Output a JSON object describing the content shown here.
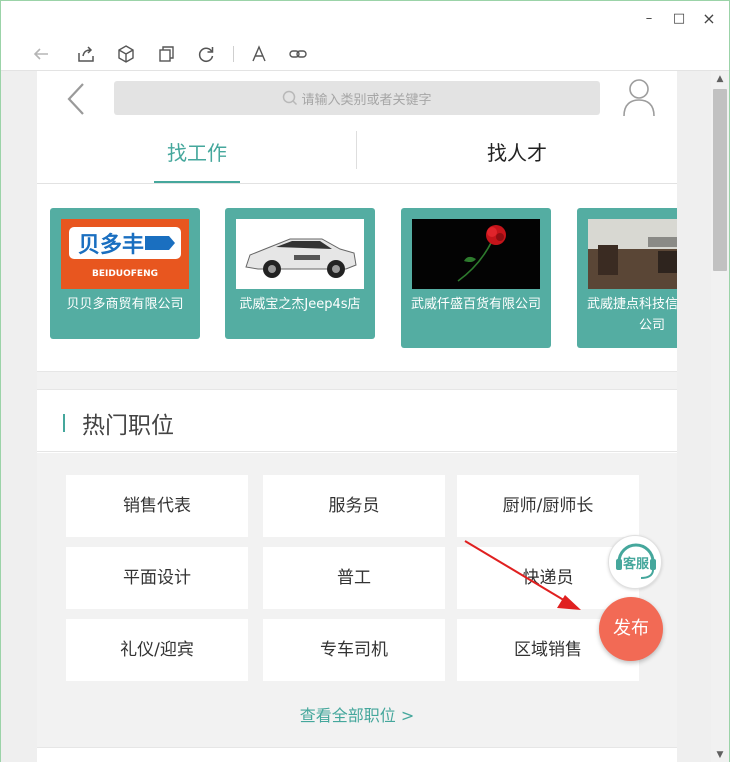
{
  "window": {
    "controls": {
      "minimize": "–",
      "maximize": "□",
      "close": "×"
    }
  },
  "toolbar": {
    "icons": [
      "back-arrow-icon",
      "share-icon",
      "cube-icon",
      "copy-icon",
      "refresh-icon",
      "font-icon",
      "link-icon"
    ]
  },
  "header": {
    "search_placeholder": "请输入类别或者关键字"
  },
  "tabs": [
    {
      "label": "找工作",
      "active": true
    },
    {
      "label": "找人才",
      "active": false
    }
  ],
  "companies": [
    {
      "name": "贝贝多商贸有限公司",
      "logo_text": "贝多丰",
      "logo_sub": "BEIDUOFENG"
    },
    {
      "name": "武威宝之杰Jeep4s店"
    },
    {
      "name": "武威仟盛百货有限公司"
    },
    {
      "name": "武威捷点科技信息有限公司"
    }
  ],
  "hot_jobs": {
    "title": "热门职位",
    "items": [
      "销售代表",
      "服务员",
      "厨师/厨师长",
      "平面设计",
      "普工",
      "快递员",
      "礼仪/迎宾",
      "专车司机",
      "区域销售"
    ],
    "more_label": "查看全部职位 >"
  },
  "float": {
    "service_label": "客服",
    "publish_label": "发布"
  },
  "scrollbar": {
    "up": "▲",
    "down": "▼"
  },
  "colors": {
    "accent": "#45a79c",
    "card": "#54ada2",
    "publish": "#f26a55"
  }
}
